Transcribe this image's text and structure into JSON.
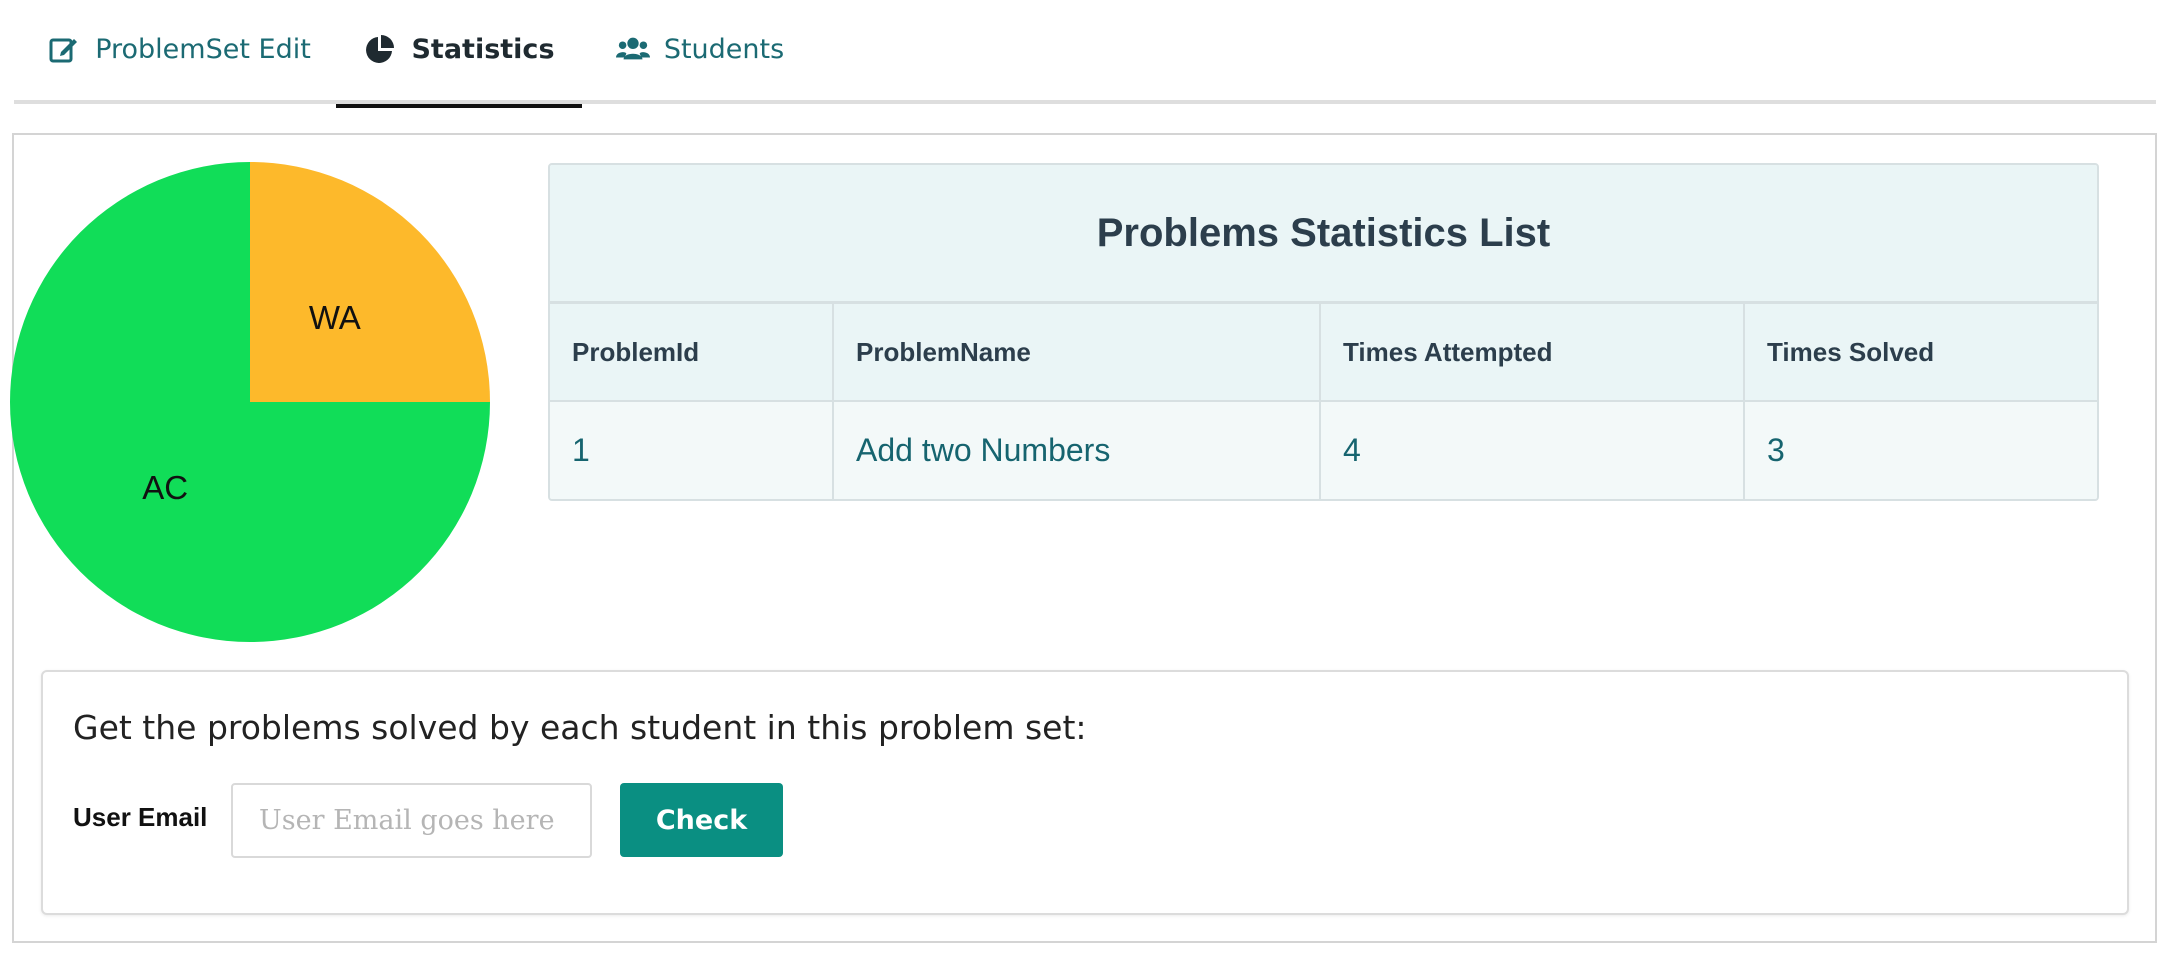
{
  "tabs": [
    {
      "label": "ProblemSet Edit",
      "icon": "edit-icon",
      "active": false
    },
    {
      "label": "Statistics",
      "icon": "pie-chart-icon",
      "active": true
    },
    {
      "label": "Students",
      "icon": "users-icon",
      "active": false
    }
  ],
  "chart_data": {
    "type": "pie",
    "categories": [
      "AC",
      "WA"
    ],
    "values": [
      3,
      1
    ],
    "colors": [
      "#11dd58",
      "#fdb92b"
    ]
  },
  "stats_table": {
    "title": "Problems Statistics List",
    "columns": [
      "ProblemId",
      "ProblemName",
      "Times Attempted",
      "Times Solved"
    ],
    "rows": [
      {
        "id": "1",
        "name": "Add two Numbers",
        "attempted": "4",
        "solved": "3"
      }
    ]
  },
  "lookup": {
    "heading": "Get the problems solved by each student in this problem set:",
    "email_label": "User Email",
    "email_placeholder": "User Email goes here",
    "email_value": "",
    "button_label": "Check"
  },
  "colors": {
    "accent": "#0a8f82",
    "link": "#16646f",
    "tab_text": "#1b6a73"
  }
}
